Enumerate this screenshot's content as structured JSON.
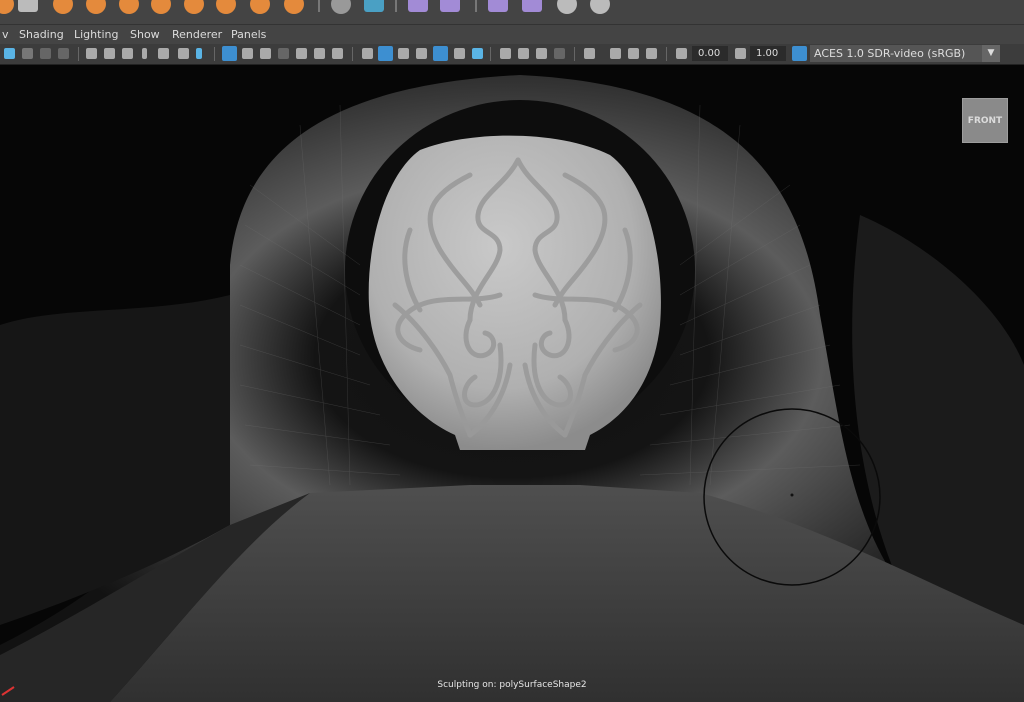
{
  "menubar": {
    "items": [
      "v",
      "Shading",
      "Lighting",
      "Show",
      "Renderer",
      "Panels"
    ]
  },
  "toolbar": {
    "exposure_value": "0.00",
    "gamma_value": "1.00",
    "colorspace": "ACES 1.0 SDR-video (sRGB)"
  },
  "viewport": {
    "viewcube_label": "FRONT",
    "status_text": "Sculpting on: polySurfaceShape2"
  },
  "colors": {
    "ui_bg": "#444444",
    "toolbar_bg": "#3c3c3c",
    "shelf_icon_orange": "#e48a3c",
    "shelf_icon_purple": "#a28bd6",
    "active_button_blue": "#3d8fd1"
  }
}
